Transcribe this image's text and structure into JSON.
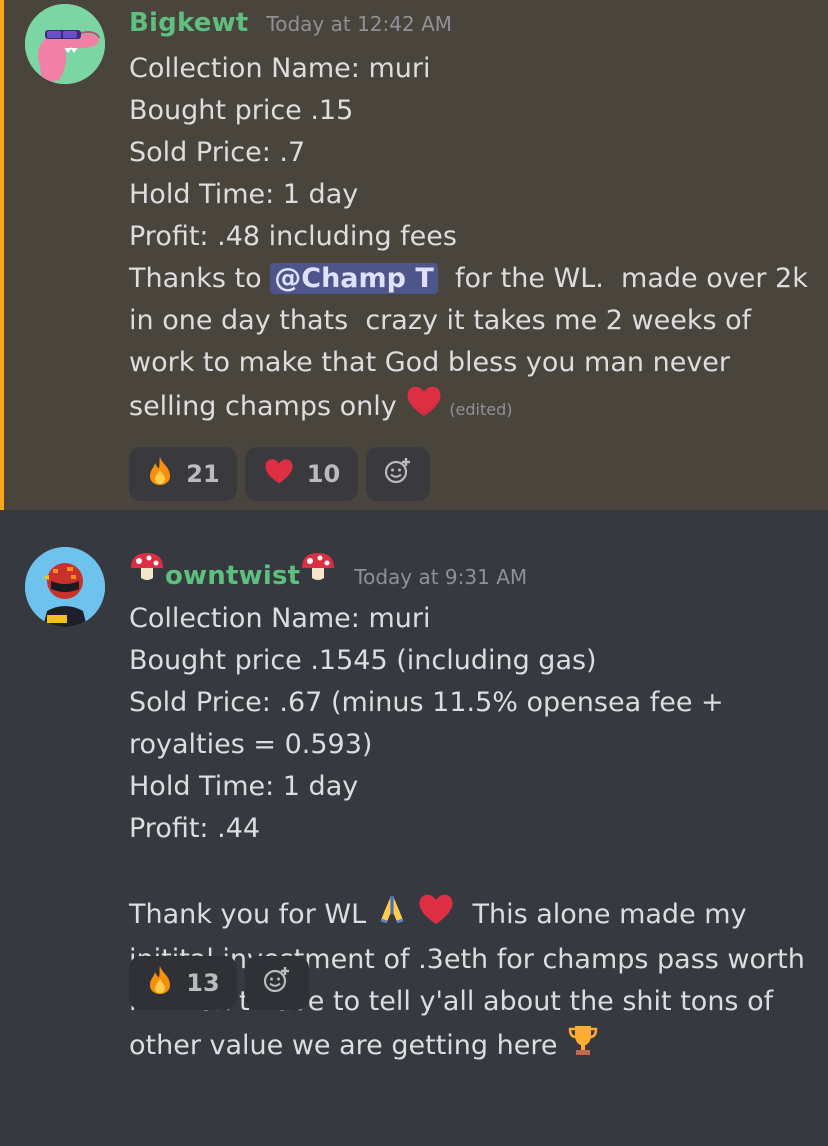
{
  "messages": [
    {
      "username": "Bigkewt",
      "timestamp": "Today at 12:42 AM",
      "lines": [
        "Collection Name: muri",
        "Bought price .15",
        "Sold Price: .7",
        "Hold Time: 1 day",
        "Profit: .48 including fees"
      ],
      "thanks_pre": "Thanks to ",
      "mention": "@Champ T",
      "thanks_post": "  for the WL.  made over 2k in one day thats  crazy it takes me 2 weeks of work to make that God bless you man never selling champs only ",
      "edited": "(edited)",
      "reactions": [
        {
          "icon": "fire-icon",
          "count": "21"
        },
        {
          "icon": "heart-icon",
          "count": "10"
        }
      ]
    },
    {
      "username": "owntwist",
      "timestamp": "Today at 9:31 AM",
      "lines": [
        "Collection Name: muri",
        "Bought price .1545 (including gas)",
        "Sold Price: .67 (minus 11.5% opensea fee + royalties = 0.593)",
        "Hold Time: 1 day",
        "Profit: .44"
      ],
      "thanks_pre": "Thank you for WL ",
      "thanks_post": "  This alone made my initital investment of .3eth for champs pass worth it. I don't have to tell y'all about the shit tons of other value we are getting here ",
      "reactions": [
        {
          "icon": "fire-icon",
          "count": "13"
        }
      ]
    }
  ],
  "colors": {
    "highlight_bg": "#49443c",
    "highlight_border": "#faa81a",
    "username": "#5fbf7e",
    "mention_bg": "#4e5589",
    "channel_bg": "#36393f"
  }
}
